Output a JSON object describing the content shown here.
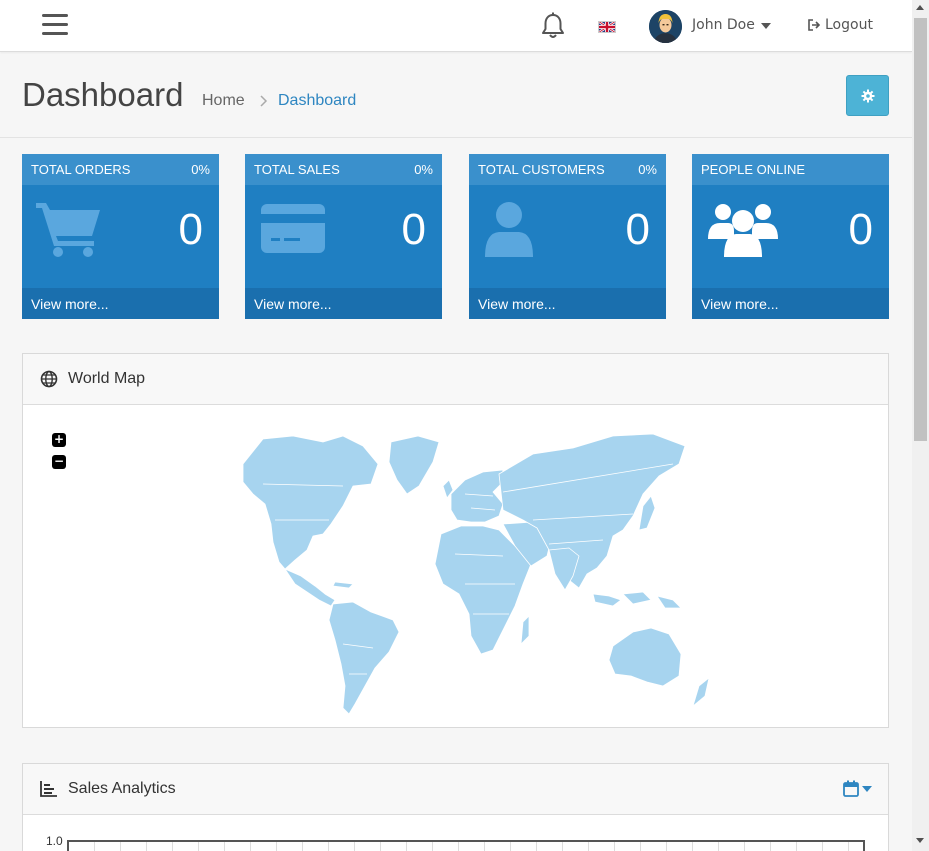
{
  "header": {
    "user_name": "John Doe",
    "logout_label": "Logout",
    "icons": [
      "menu-icon",
      "bell-icon",
      "uk-flag-icon",
      "avatar",
      "logout-icon"
    ]
  },
  "page": {
    "title": "Dashboard",
    "breadcrumb": [
      "Home",
      "Dashboard"
    ]
  },
  "tiles": [
    {
      "title": "TOTAL ORDERS",
      "percent": "0%",
      "value": "0",
      "link": "View more...",
      "icon": "shopping-cart-icon"
    },
    {
      "title": "TOTAL SALES",
      "percent": "0%",
      "value": "0",
      "link": "View more...",
      "icon": "credit-card-icon"
    },
    {
      "title": "TOTAL CUSTOMERS",
      "percent": "0%",
      "value": "0",
      "link": "View more...",
      "icon": "user-icon"
    },
    {
      "title": "PEOPLE ONLINE",
      "percent": "",
      "value": "0",
      "link": "View more...",
      "icon": "users-icon"
    }
  ],
  "world_map": {
    "title": "World Map",
    "zoom_in": "+",
    "zoom_out": "−"
  },
  "sales_analytics": {
    "title": "Sales Analytics",
    "y_tick_top": "1.0"
  },
  "colors": {
    "tile_bg": "#1f7fc2",
    "tile_head": "#3a90cc",
    "tile_foot": "#1a6fae",
    "accent": "#2e86c1",
    "settings_button": "#4db3d6",
    "map_land": "#a7d4ef"
  }
}
